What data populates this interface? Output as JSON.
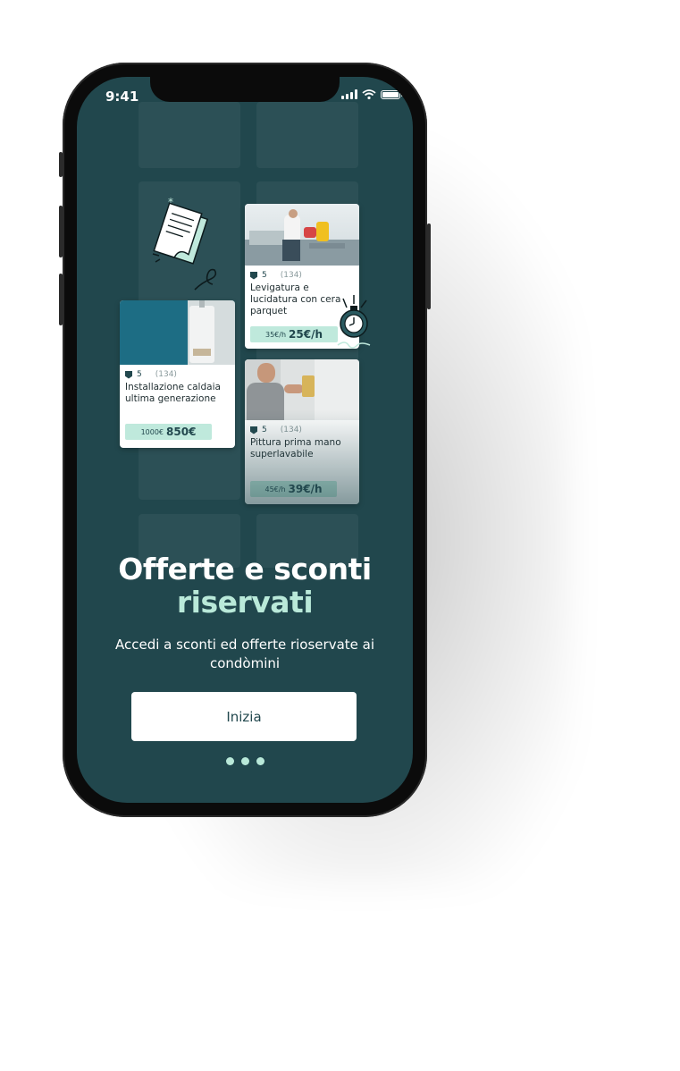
{
  "status_bar": {
    "time": "9:41"
  },
  "cards": [
    {
      "rating": "5",
      "reviews": "(134)",
      "title": "Levigatura e lucidatura con cera parquet",
      "old_price": "35€/h",
      "new_price": "25€/h"
    },
    {
      "rating": "5",
      "reviews": "(134)",
      "title": "Installazione caldaia ultima generazione",
      "old_price": "1000€",
      "new_price": "850€"
    },
    {
      "rating": "5",
      "reviews": "(134)",
      "title": "Pittura prima mano superlavabile",
      "old_price": "45€/h",
      "new_price": "39€/h"
    }
  ],
  "onboarding": {
    "title_line1": "Offerte e sconti",
    "title_line2": "riservati",
    "subtitle": "Accedi a sconti ed offerte rioservate ai condòmini",
    "cta_label": "Inizia",
    "page_count": 3
  },
  "colors": {
    "background": "#21474d",
    "accent": "#b9e9d9",
    "price_tag": "#bfe9dc",
    "button": "#ffffff"
  },
  "icons": [
    "document-doodle-icon",
    "stopwatch-doodle-icon",
    "rating-badge-icon"
  ]
}
